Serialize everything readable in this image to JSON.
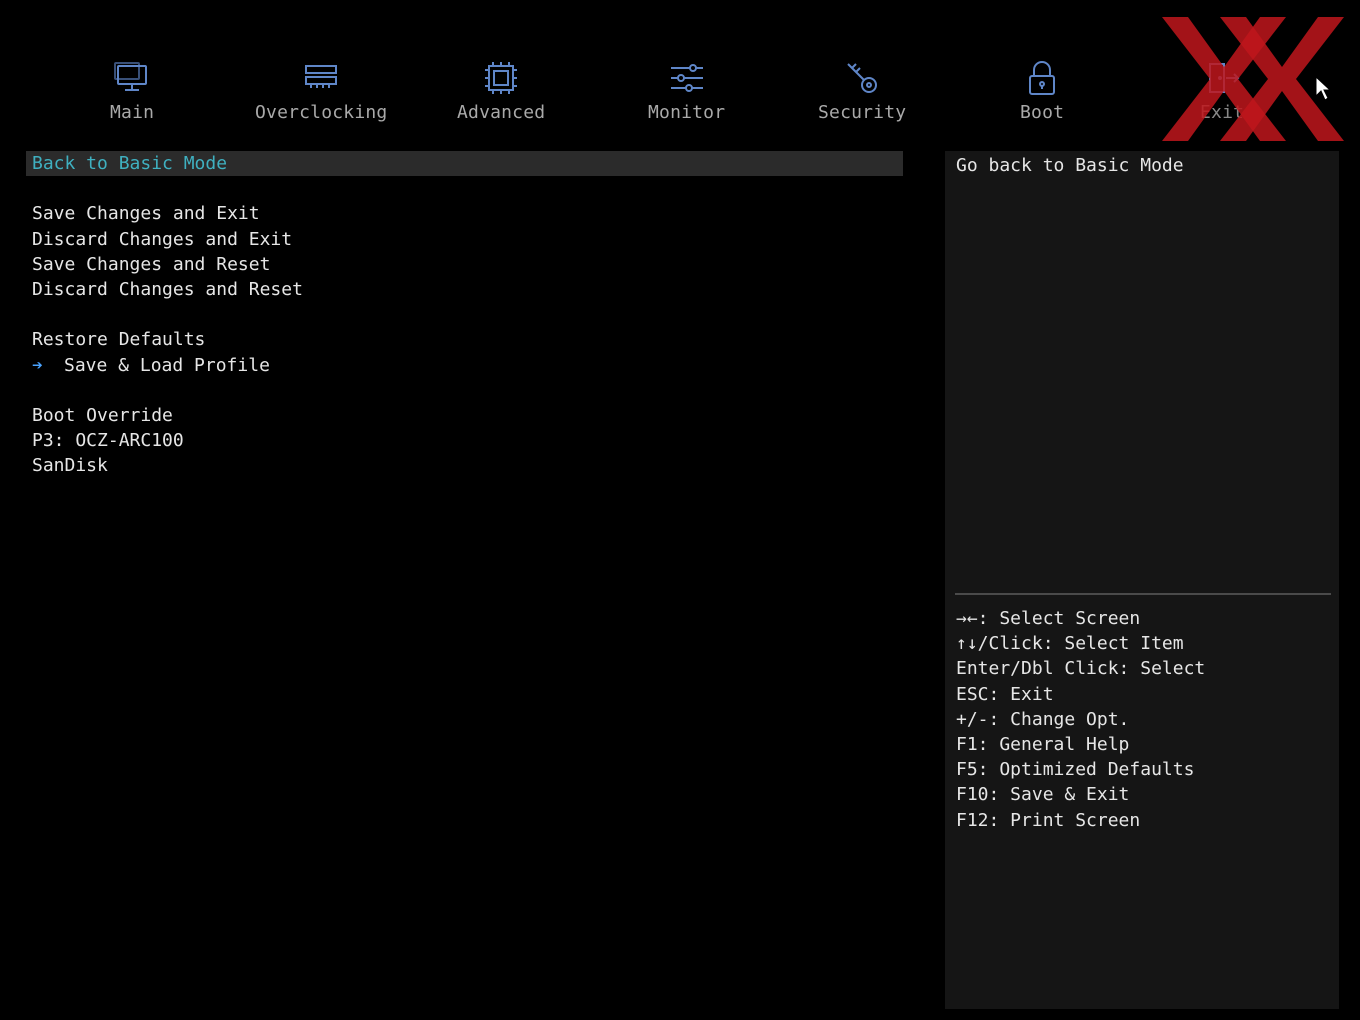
{
  "tabs": [
    {
      "id": "main",
      "label": "Main",
      "icon": "monitor-icon"
    },
    {
      "id": "overclocking",
      "label": "Overclocking",
      "icon": "memory-icon"
    },
    {
      "id": "advanced",
      "label": "Advanced",
      "icon": "chip-icon"
    },
    {
      "id": "monitor",
      "label": "Monitor",
      "icon": "sliders-icon"
    },
    {
      "id": "security",
      "label": "Security",
      "icon": "key-icon"
    },
    {
      "id": "boot",
      "label": "Boot",
      "icon": "lock-icon"
    },
    {
      "id": "exit",
      "label": "Exit",
      "icon": "exit-door-icon",
      "active": true
    }
  ],
  "menu": {
    "back_basic": "Back to Basic Mode",
    "save_exit": "Save Changes and Exit",
    "discard_exit": "Discard Changes and Exit",
    "save_reset": "Save Changes and Reset",
    "discard_reset": "Discard Changes and Reset",
    "restore_defaults": "Restore Defaults",
    "save_load_profile": "Save & Load Profile",
    "boot_override": "Boot Override",
    "boot_device_1": "P3: OCZ-ARC100",
    "boot_device_2": "SanDisk"
  },
  "help": {
    "description": "Go back to Basic Mode",
    "keys": [
      "→←: Select Screen",
      "↑↓/Click: Select Item",
      "Enter/Dbl Click: Select",
      "ESC: Exit",
      "+/-: Change Opt.",
      "F1: General Help",
      "F5: Optimized Defaults",
      "F10: Save & Exit",
      "F12: Print Screen"
    ]
  },
  "colors": {
    "background": "#000000",
    "selected_text": "#3fb0c0",
    "selected_bg": "#2b2b2b",
    "icon": "#5f86c8",
    "logo_red": "#c0161c",
    "help_panel_bg": "#151515"
  }
}
